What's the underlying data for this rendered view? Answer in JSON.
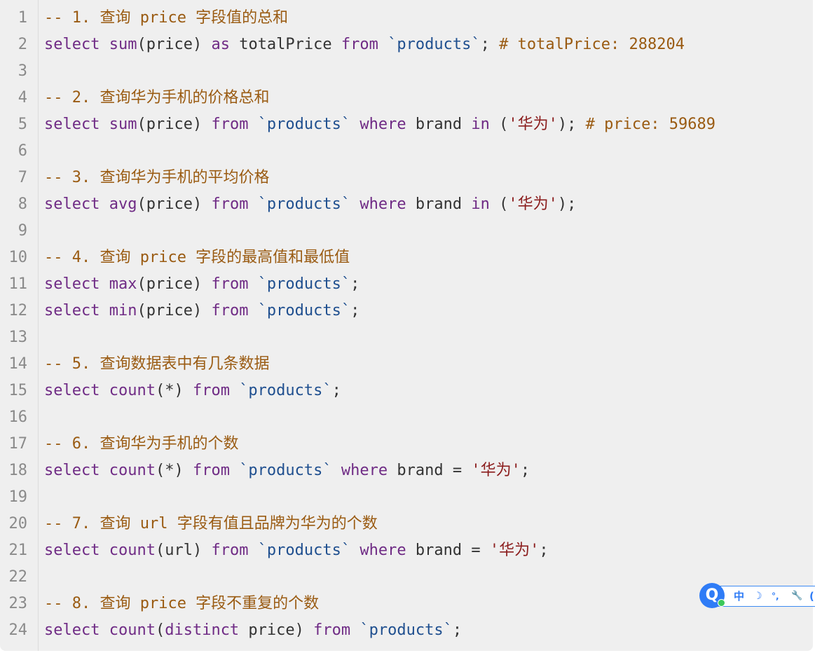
{
  "editor": {
    "lines": [
      {
        "num": "1",
        "tokens": [
          {
            "t": "-- 1. 查询 price 字段值的总和",
            "c": "cm"
          }
        ]
      },
      {
        "num": "2",
        "tokens": [
          {
            "t": "select",
            "c": "kw"
          },
          {
            "t": " ",
            "c": "pu"
          },
          {
            "t": "sum",
            "c": "fn"
          },
          {
            "t": "(price) ",
            "c": "pu"
          },
          {
            "t": "as",
            "c": "kw"
          },
          {
            "t": " totalPrice ",
            "c": "pu"
          },
          {
            "t": "from",
            "c": "kw"
          },
          {
            "t": " ",
            "c": "pu"
          },
          {
            "t": "`products`",
            "c": "id"
          },
          {
            "t": "; ",
            "c": "pu"
          },
          {
            "t": "# totalPrice: 288204",
            "c": "cm"
          }
        ]
      },
      {
        "num": "3",
        "tokens": []
      },
      {
        "num": "4",
        "tokens": [
          {
            "t": "-- 2. 查询华为手机的价格总和",
            "c": "cm"
          }
        ]
      },
      {
        "num": "5",
        "tokens": [
          {
            "t": "select",
            "c": "kw"
          },
          {
            "t": " ",
            "c": "pu"
          },
          {
            "t": "sum",
            "c": "fn"
          },
          {
            "t": "(price) ",
            "c": "pu"
          },
          {
            "t": "from",
            "c": "kw"
          },
          {
            "t": " ",
            "c": "pu"
          },
          {
            "t": "`products`",
            "c": "id"
          },
          {
            "t": " ",
            "c": "pu"
          },
          {
            "t": "where",
            "c": "kw"
          },
          {
            "t": " brand ",
            "c": "pu"
          },
          {
            "t": "in",
            "c": "kw"
          },
          {
            "t": " (",
            "c": "pu"
          },
          {
            "t": "'华为'",
            "c": "str"
          },
          {
            "t": "); ",
            "c": "pu"
          },
          {
            "t": "# price: 59689",
            "c": "cm"
          }
        ]
      },
      {
        "num": "6",
        "tokens": []
      },
      {
        "num": "7",
        "tokens": [
          {
            "t": "-- 3. 查询华为手机的平均价格",
            "c": "cm"
          }
        ]
      },
      {
        "num": "8",
        "tokens": [
          {
            "t": "select",
            "c": "kw"
          },
          {
            "t": " ",
            "c": "pu"
          },
          {
            "t": "avg",
            "c": "fn"
          },
          {
            "t": "(price) ",
            "c": "pu"
          },
          {
            "t": "from",
            "c": "kw"
          },
          {
            "t": " ",
            "c": "pu"
          },
          {
            "t": "`products`",
            "c": "id"
          },
          {
            "t": " ",
            "c": "pu"
          },
          {
            "t": "where",
            "c": "kw"
          },
          {
            "t": " brand ",
            "c": "pu"
          },
          {
            "t": "in",
            "c": "kw"
          },
          {
            "t": " (",
            "c": "pu"
          },
          {
            "t": "'华为'",
            "c": "str"
          },
          {
            "t": ");",
            "c": "pu"
          }
        ]
      },
      {
        "num": "9",
        "tokens": []
      },
      {
        "num": "10",
        "tokens": [
          {
            "t": "-- 4. 查询 price 字段的最高值和最低值",
            "c": "cm"
          }
        ]
      },
      {
        "num": "11",
        "tokens": [
          {
            "t": "select",
            "c": "kw"
          },
          {
            "t": " ",
            "c": "pu"
          },
          {
            "t": "max",
            "c": "fn"
          },
          {
            "t": "(price) ",
            "c": "pu"
          },
          {
            "t": "from",
            "c": "kw"
          },
          {
            "t": " ",
            "c": "pu"
          },
          {
            "t": "`products`",
            "c": "id"
          },
          {
            "t": ";",
            "c": "pu"
          }
        ]
      },
      {
        "num": "12",
        "tokens": [
          {
            "t": "select",
            "c": "kw"
          },
          {
            "t": " ",
            "c": "pu"
          },
          {
            "t": "min",
            "c": "fn"
          },
          {
            "t": "(price) ",
            "c": "pu"
          },
          {
            "t": "from",
            "c": "kw"
          },
          {
            "t": " ",
            "c": "pu"
          },
          {
            "t": "`products`",
            "c": "id"
          },
          {
            "t": ";",
            "c": "pu"
          }
        ]
      },
      {
        "num": "13",
        "tokens": []
      },
      {
        "num": "14",
        "tokens": [
          {
            "t": "-- 5. 查询数据表中有几条数据",
            "c": "cm"
          }
        ]
      },
      {
        "num": "15",
        "tokens": [
          {
            "t": "select",
            "c": "kw"
          },
          {
            "t": " ",
            "c": "pu"
          },
          {
            "t": "count",
            "c": "fn"
          },
          {
            "t": "(*) ",
            "c": "pu"
          },
          {
            "t": "from",
            "c": "kw"
          },
          {
            "t": " ",
            "c": "pu"
          },
          {
            "t": "`products`",
            "c": "id"
          },
          {
            "t": ";",
            "c": "pu"
          }
        ]
      },
      {
        "num": "16",
        "tokens": []
      },
      {
        "num": "17",
        "tokens": [
          {
            "t": "-- 6. 查询华为手机的个数",
            "c": "cm"
          }
        ]
      },
      {
        "num": "18",
        "tokens": [
          {
            "t": "select",
            "c": "kw"
          },
          {
            "t": " ",
            "c": "pu"
          },
          {
            "t": "count",
            "c": "fn"
          },
          {
            "t": "(*) ",
            "c": "pu"
          },
          {
            "t": "from",
            "c": "kw"
          },
          {
            "t": " ",
            "c": "pu"
          },
          {
            "t": "`products`",
            "c": "id"
          },
          {
            "t": " ",
            "c": "pu"
          },
          {
            "t": "where",
            "c": "kw"
          },
          {
            "t": " brand = ",
            "c": "pu"
          },
          {
            "t": "'华为'",
            "c": "str"
          },
          {
            "t": ";",
            "c": "pu"
          }
        ]
      },
      {
        "num": "19",
        "tokens": []
      },
      {
        "num": "20",
        "tokens": [
          {
            "t": "-- 7. 查询 url 字段有值且品牌为华为的个数",
            "c": "cm"
          }
        ]
      },
      {
        "num": "21",
        "tokens": [
          {
            "t": "select",
            "c": "kw"
          },
          {
            "t": " ",
            "c": "pu"
          },
          {
            "t": "count",
            "c": "fn"
          },
          {
            "t": "(url) ",
            "c": "pu"
          },
          {
            "t": "from",
            "c": "kw"
          },
          {
            "t": " ",
            "c": "pu"
          },
          {
            "t": "`products`",
            "c": "id"
          },
          {
            "t": " ",
            "c": "pu"
          },
          {
            "t": "where",
            "c": "kw"
          },
          {
            "t": " brand = ",
            "c": "pu"
          },
          {
            "t": "'华为'",
            "c": "str"
          },
          {
            "t": ";",
            "c": "pu"
          }
        ]
      },
      {
        "num": "22",
        "tokens": []
      },
      {
        "num": "23",
        "tokens": [
          {
            "t": "-- 8. 查询 price 字段不重复的个数",
            "c": "cm"
          }
        ]
      },
      {
        "num": "24",
        "tokens": [
          {
            "t": "select",
            "c": "kw"
          },
          {
            "t": " ",
            "c": "pu"
          },
          {
            "t": "count",
            "c": "fn"
          },
          {
            "t": "(",
            "c": "pu"
          },
          {
            "t": "distinct",
            "c": "kw"
          },
          {
            "t": " price) ",
            "c": "pu"
          },
          {
            "t": "from",
            "c": "kw"
          },
          {
            "t": " ",
            "c": "pu"
          },
          {
            "t": "`products`",
            "c": "id"
          },
          {
            "t": ";",
            "c": "pu"
          }
        ]
      }
    ]
  },
  "ime_toolbar": {
    "logo_letter": "Q",
    "items": [
      {
        "label": "中",
        "icon": "chinese-mode-icon"
      },
      {
        "label": "☽",
        "icon": "moon-icon"
      },
      {
        "label": "°,",
        "icon": "punctuation-icon"
      },
      {
        "label": "🔧",
        "icon": "wrench-icon"
      },
      {
        "label": "(",
        "icon": "more-icon"
      }
    ]
  },
  "colors": {
    "keyword": "#6f2b85",
    "identifier": "#1f4f8f",
    "string": "#8b1d1d",
    "comment": "#9a5b12",
    "background": "#efefef"
  }
}
